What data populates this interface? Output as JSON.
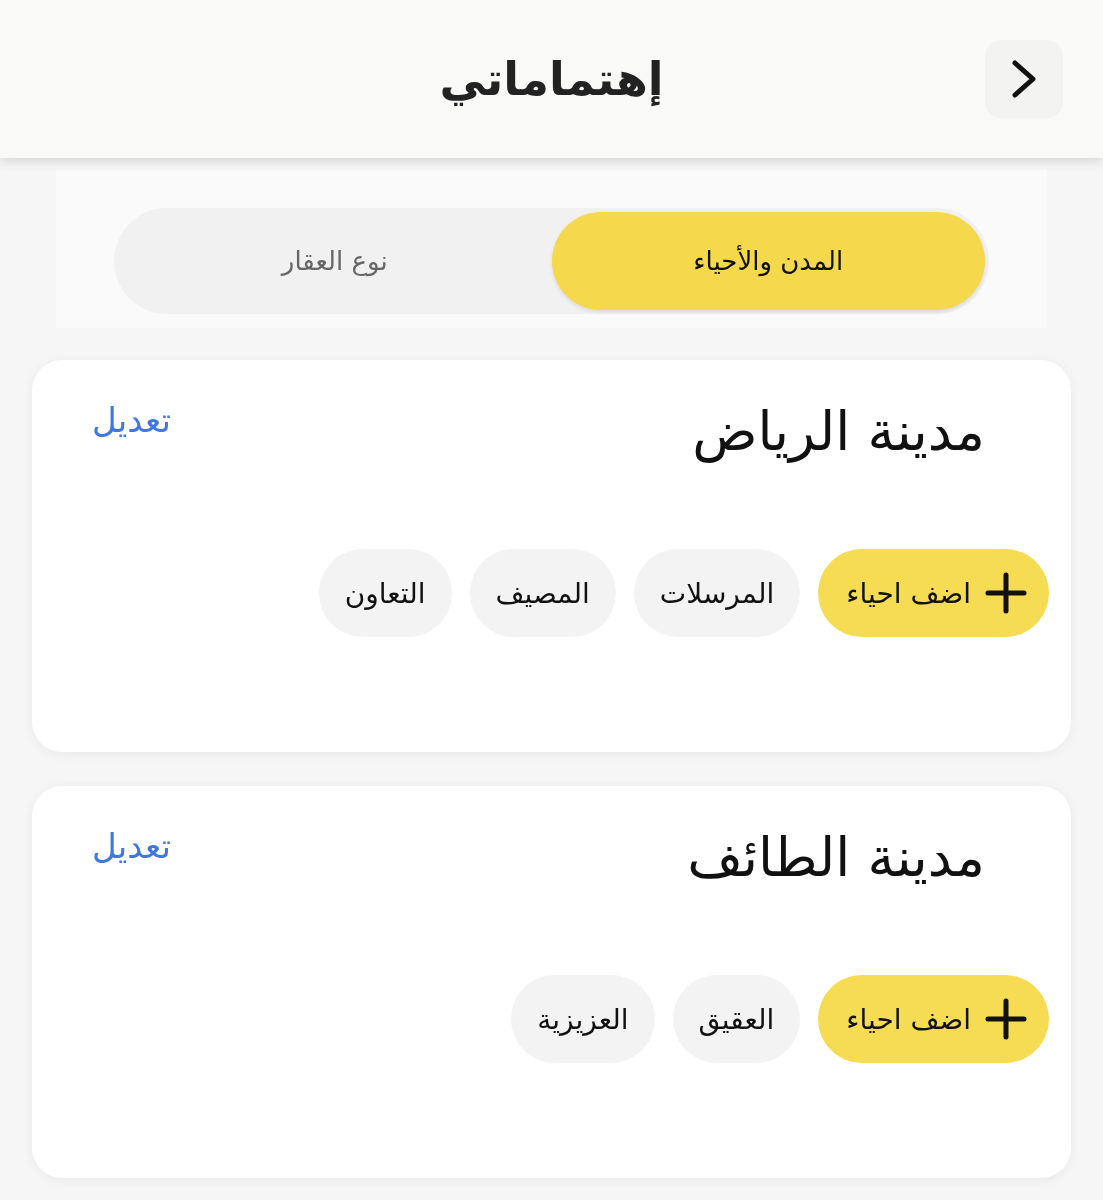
{
  "header": {
    "title": "إهتماماتي"
  },
  "tabs": [
    {
      "label": "المدن والأحياء",
      "selected": true
    },
    {
      "label": "نوع العقار",
      "selected": false
    }
  ],
  "cities": [
    {
      "name": "مدينة الرياض",
      "edit": "تعديل",
      "add": "اضف احياء",
      "districts": [
        "المرسلات",
        "المصيف",
        "التعاون"
      ]
    },
    {
      "name": "مدينة الطائف",
      "edit": "تعديل",
      "add": "اضف احياء",
      "districts": [
        "العقيق",
        "العزيزية"
      ]
    }
  ]
}
